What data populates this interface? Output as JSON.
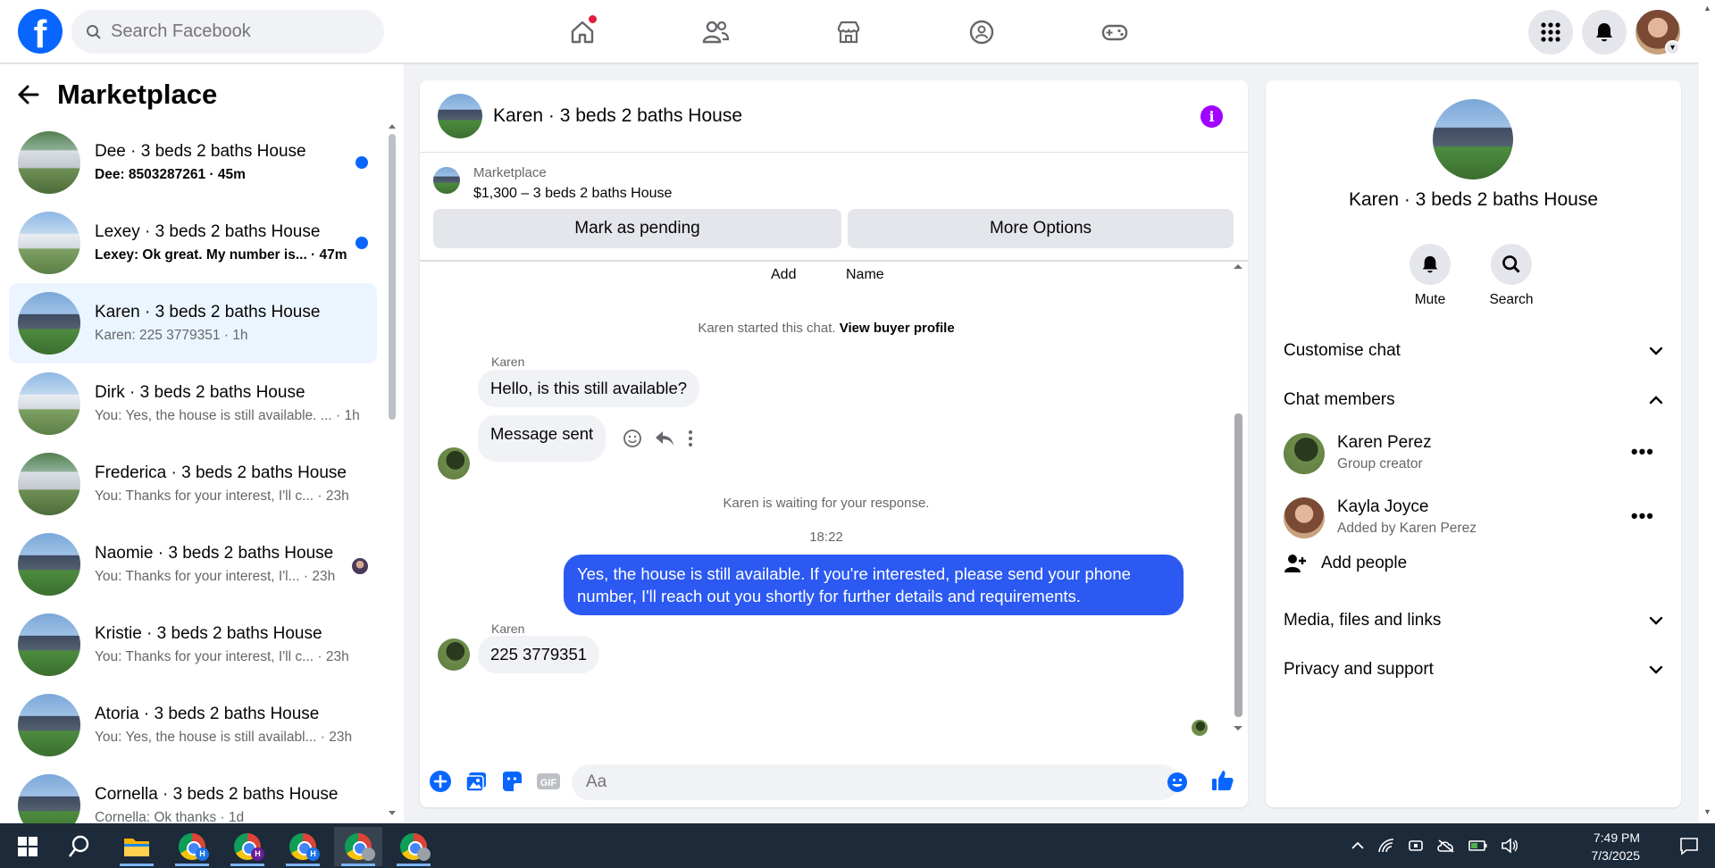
{
  "topbar": {
    "logo": "f",
    "search_placeholder": "Search Facebook",
    "nav_icons": [
      "home-icon",
      "friends-icon",
      "marketplace-icon",
      "groups-icon",
      "gaming-icon"
    ],
    "right_icons": [
      "menu-grid-icon",
      "notifications-icon"
    ],
    "brand_color": "#0866ff"
  },
  "left": {
    "title": "Marketplace",
    "conversations": [
      {
        "title": "Dee · 3 beds 2 baths House",
        "preview": "Dee: 8503287261",
        "time": "45m",
        "unread": true,
        "thumb": "tree"
      },
      {
        "title": "Lexey · 3 beds 2 baths House",
        "preview": "Lexey: Ok great. My number is...",
        "time": "47m",
        "unread": true,
        "thumb": "white"
      },
      {
        "title": "Karen · 3 beds 2 baths House",
        "preview": "Karen: 225 3779351",
        "time": "1h",
        "active": true,
        "thumb": "house"
      },
      {
        "title": "Dirk · 3 beds 2 baths House",
        "preview": "You: Yes, the house is still available. ...",
        "time": "1h",
        "thumb": "white"
      },
      {
        "title": "Frederica · 3 beds 2 baths House",
        "preview": "You: Thanks for your interest, I'll c...",
        "time": "23h",
        "thumb": "tree"
      },
      {
        "title": "Naomie · 3 beds 2 baths House",
        "preview": "You: Thanks for your interest, I'l...",
        "time": "23h",
        "seen": true,
        "thumb": "house"
      },
      {
        "title": "Kristie · 3 beds 2 baths House",
        "preview": "You: Thanks for your interest, I'll c...",
        "time": "23h",
        "thumb": "house"
      },
      {
        "title": "Atoria · 3 beds 2 baths House",
        "preview": "You: Yes, the house is still availabl...",
        "time": "23h",
        "thumb": "house"
      },
      {
        "title": "Cornella · 3 beds 2 baths House",
        "preview": "Cornella: Ok thanks",
        "time": "1d",
        "thumb": "house"
      }
    ]
  },
  "chat": {
    "title": "Karen · 3 beds 2 baths House",
    "marketplace_label": "Marketplace",
    "listing": "$1,300 – 3 beds 2 baths House",
    "btn_pending": "Mark as pending",
    "btn_more": "More Options",
    "top_add": "Add",
    "top_name": "Name",
    "started_text": "Karen started this chat.",
    "buyer_link": "View buyer profile",
    "sender": "Karen",
    "msg1": "Hello, is this still available?",
    "msg2": "Message sent",
    "waiting": "Karen is waiting for your response.",
    "time": "18:22",
    "out_msg": "Yes, the house is still available. If you're interested, please send your phone number, I'll reach out you shortly for further details and requirements.",
    "sender2": "Karen",
    "msg3": "225 3779351",
    "composer_placeholder": "Aa",
    "accent": "#2b59f2"
  },
  "right": {
    "title": "Karen · 3 beds 2 baths House",
    "mute": "Mute",
    "search": "Search",
    "customise": "Customise chat",
    "members_header": "Chat members",
    "members": [
      {
        "name": "Karen Perez",
        "role": "Group creator"
      },
      {
        "name": "Kayla Joyce",
        "role": "Added by Karen Perez"
      }
    ],
    "add_people": "Add people",
    "media": "Media, files and links",
    "privacy": "Privacy and support"
  },
  "taskbar": {
    "time": "7:49 PM",
    "date": "7/3/2025",
    "badges": [
      "H",
      "H",
      "H"
    ]
  }
}
